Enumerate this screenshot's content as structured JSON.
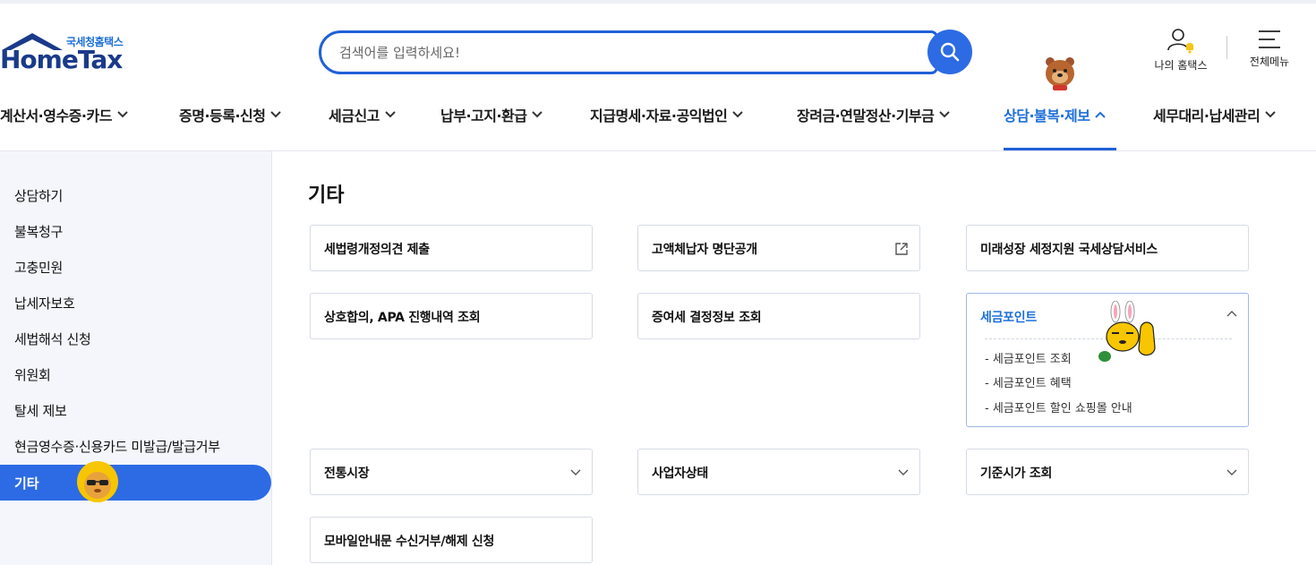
{
  "header": {
    "logo_sub": "국세청홈택스",
    "logo_main": "HomeTax",
    "search_placeholder": "검색어를 입력하세요!",
    "my_hometax": "나의 홈택스",
    "all_menu": "전체메뉴"
  },
  "gnb": [
    {
      "label": "계산서·영수증·카드"
    },
    {
      "label": "증명·등록·신청"
    },
    {
      "label": "세금신고"
    },
    {
      "label": "납부·고지·환급"
    },
    {
      "label": "지급명세·자료·공익법인"
    },
    {
      "label": "장려금·연말정산·기부금"
    },
    {
      "label": "상담·불복·제보"
    },
    {
      "label": "세무대리·납세관리"
    }
  ],
  "lnb": {
    "items": [
      {
        "label": "상담하기"
      },
      {
        "label": "불복청구"
      },
      {
        "label": "고충민원"
      },
      {
        "label": "납세자보호"
      },
      {
        "label": "세법해석 신청"
      },
      {
        "label": "위원회"
      },
      {
        "label": "탈세 제보"
      },
      {
        "label": "현금영수증·신용카드 미발급/발급거부"
      },
      {
        "label": "기타"
      }
    ]
  },
  "content": {
    "title": "기타",
    "cards": [
      {
        "label": "세법령개정의견 제출"
      },
      {
        "label": "고액체납자 명단공개"
      },
      {
        "label": "미래성장 세정지원 국세상담서비스"
      },
      {
        "label": "상호합의, APA 진행내역 조회"
      },
      {
        "label": "증여세 결정정보 조회"
      },
      {
        "label": "세금포인트"
      },
      {
        "label": "전통시장"
      },
      {
        "label": "사업자상태"
      },
      {
        "label": "기준시가 조회"
      },
      {
        "label": "모바일안내문 수신거부/해제 신청"
      }
    ],
    "tax_point_subs": [
      {
        "label": "세금포인트 조회"
      },
      {
        "label": "세금포인트 혜택"
      },
      {
        "label": "세금포인트 할인 쇼핑몰 안내"
      }
    ]
  },
  "colors": {
    "accent": "#2d6be4",
    "active_text": "#1d6fd9",
    "lnb_bg": "#f4f6fb"
  }
}
